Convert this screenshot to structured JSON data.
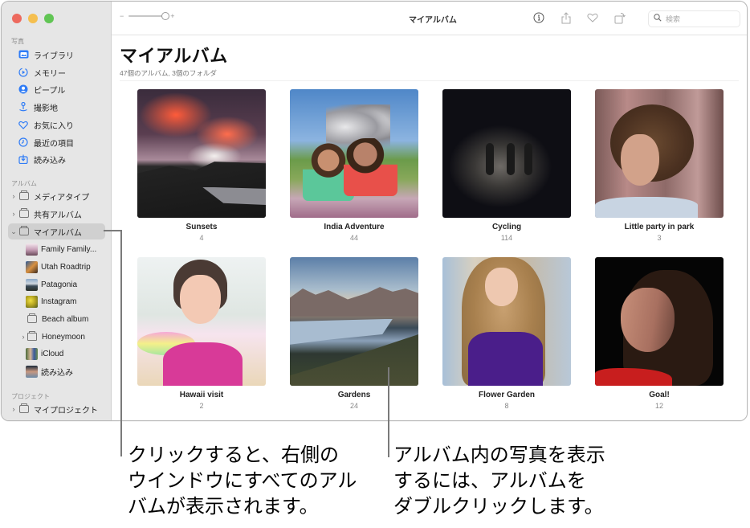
{
  "window": {
    "title": "マイアルバム"
  },
  "sidebar": {
    "sections": {
      "photos": "写真",
      "albums": "アルバム",
      "projects": "プロジェクト"
    },
    "library_items": [
      {
        "label": "ライブラリ",
        "icon": "library-icon"
      },
      {
        "label": "メモリー",
        "icon": "memories-icon"
      },
      {
        "label": "ピープル",
        "icon": "people-icon"
      },
      {
        "label": "撮影地",
        "icon": "places-icon"
      },
      {
        "label": "お気に入り",
        "icon": "heart-icon"
      },
      {
        "label": "最近の項目",
        "icon": "clock-icon"
      },
      {
        "label": "読み込み",
        "icon": "import-icon"
      }
    ],
    "album_groups": [
      {
        "label": "メディアタイプ",
        "expanded": false
      },
      {
        "label": "共有アルバム",
        "expanded": false
      },
      {
        "label": "マイアルバム",
        "expanded": true,
        "selected": true
      }
    ],
    "my_albums": [
      {
        "label": "Family Family..."
      },
      {
        "label": "Utah Roadtrip"
      },
      {
        "label": "Patagonia"
      },
      {
        "label": "Instagram"
      },
      {
        "label": "Beach album"
      },
      {
        "label": "Honeymoon",
        "folder": true
      },
      {
        "label": "iCloud"
      },
      {
        "label": "読み込み"
      }
    ],
    "projects": [
      {
        "label": "マイプロジェクト"
      }
    ]
  },
  "toolbar": {
    "zoom_minus": "−",
    "zoom_plus": "+",
    "zoom_level": 1.0,
    "title": "マイアルバム",
    "search_placeholder": "検索",
    "search_value": ""
  },
  "main": {
    "title": "マイアルバム",
    "subtitle": "47個のアルバム, 3個のフォルダ",
    "albums": [
      {
        "name": "Sunsets",
        "count": "4"
      },
      {
        "name": "India Adventure",
        "count": "44"
      },
      {
        "name": "Cycling",
        "count": "114"
      },
      {
        "name": "Little party in park",
        "count": "3"
      },
      {
        "name": "Hawaii visit",
        "count": "2"
      },
      {
        "name": "Gardens",
        "count": "24"
      },
      {
        "name": "Flower Garden",
        "count": "8"
      },
      {
        "name": "Goal!",
        "count": "12"
      }
    ]
  },
  "callouts": {
    "left": "クリックすると、右側の\nウインドウにすべてのアル\nバムが表示されます。",
    "right": "アルバム内の写真を表示\nするには、アルバムを\nダブルクリックします。"
  },
  "colors": {
    "accent": "#2f7cf6",
    "sidebar_bg": "#e6e6e6",
    "selected_bg": "#d0d0d0",
    "traffic_red": "#ed6a5e",
    "traffic_yellow": "#f5bf4f",
    "traffic_green": "#61c554"
  }
}
